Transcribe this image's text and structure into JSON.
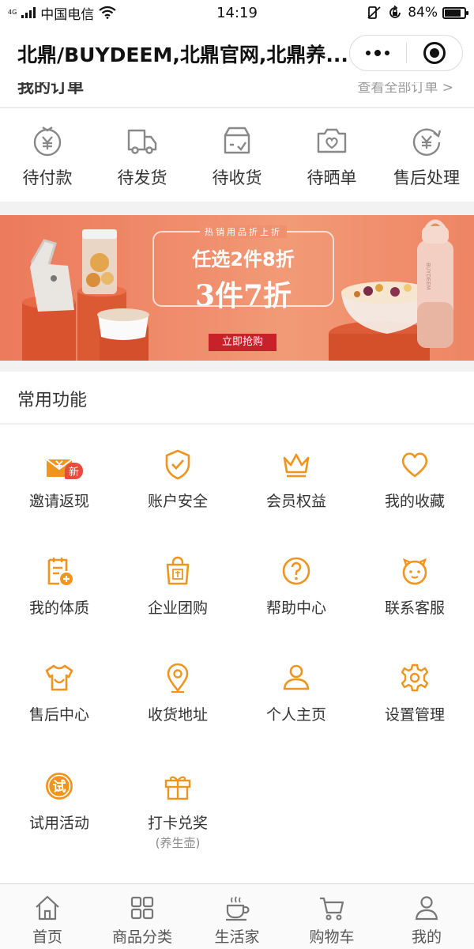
{
  "status_bar": {
    "carrier": "中国电信",
    "net": "4G",
    "time": "14:19",
    "battery": "84%",
    "battery_level": 0.84
  },
  "nav": {
    "title": "北鼎/BUYDEEM,北鼎官网,北鼎养..."
  },
  "orders": {
    "header_title": "我的订单",
    "header_link": "查看全部订单 >",
    "items": [
      {
        "label": "待付款",
        "icon": "yen-coin-icon"
      },
      {
        "label": "待发货",
        "icon": "truck-icon"
      },
      {
        "label": "待收货",
        "icon": "box-check-icon"
      },
      {
        "label": "待晒单",
        "icon": "camera-heart-icon"
      },
      {
        "label": "售后处理",
        "icon": "yen-refund-icon"
      }
    ]
  },
  "banner": {
    "tag": "热销用品折上折",
    "line1": "任选2件8折",
    "line2": "3件7折",
    "button": "立即抢购",
    "brand_mark": "BUYDEEM"
  },
  "functions": {
    "title": "常用功能",
    "badge": "新",
    "items": [
      {
        "label": "邀请返现",
        "icon": "envelope-yen-icon"
      },
      {
        "label": "账户安全",
        "icon": "shield-check-icon"
      },
      {
        "label": "会员权益",
        "icon": "crown-icon"
      },
      {
        "label": "我的收藏",
        "icon": "heart-icon"
      },
      {
        "label": "我的体质",
        "icon": "clipboard-plus-icon"
      },
      {
        "label": "企业团购",
        "icon": "shopping-bag-icon"
      },
      {
        "label": "帮助中心",
        "icon": "question-icon"
      },
      {
        "label": "联系客服",
        "icon": "face-icon"
      },
      {
        "label": "售后中心",
        "icon": "shirt-icon"
      },
      {
        "label": "收货地址",
        "icon": "location-pin-icon"
      },
      {
        "label": "个人主页",
        "icon": "user-icon"
      },
      {
        "label": "设置管理",
        "icon": "gear-icon"
      },
      {
        "label": "试用活动",
        "icon": "trial-badge-icon",
        "icon_text": "试"
      },
      {
        "label": "打卡兑奖",
        "sub": "(养生壶)",
        "icon": "gift-icon"
      }
    ]
  },
  "tabbar": {
    "items": [
      {
        "label": "首页",
        "icon": "home-icon"
      },
      {
        "label": "商品分类",
        "icon": "grid-icon"
      },
      {
        "label": "生活家",
        "icon": "cup-icon"
      },
      {
        "label": "购物车",
        "icon": "cart-icon"
      },
      {
        "label": "我的",
        "icon": "user-icon"
      }
    ]
  },
  "colors": {
    "accent": "#f0941e",
    "icon_gray": "#888888",
    "banner": "#ee8564",
    "badge": "#e84a3c"
  }
}
